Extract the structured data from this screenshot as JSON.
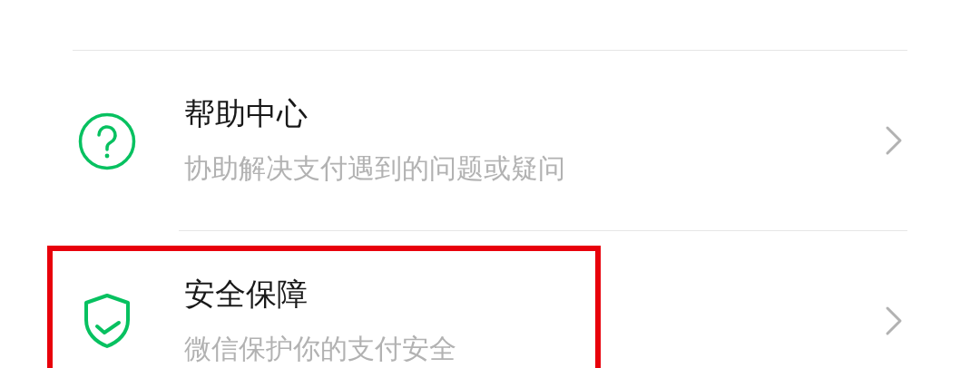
{
  "items": [
    {
      "kind": "help",
      "title": "帮助中心",
      "subtitle": "协助解决支付遇到的问题或疑问",
      "highlighted": false
    },
    {
      "kind": "shield",
      "title": "安全保障",
      "subtitle": "微信保护你的支付安全",
      "highlighted": true
    }
  ]
}
